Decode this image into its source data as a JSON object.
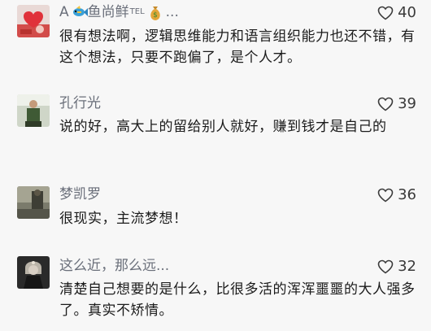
{
  "comments": [
    {
      "username_prefix": "A",
      "username_main": "鱼尚鲜",
      "username_sup": "TEL",
      "username_suffix": "...",
      "likes": "40",
      "text": "很有想法啊，逻辑思维能力和语言组织能力也还不错，有这个想法，只要不跑偏了，是个人才。"
    },
    {
      "username": "孔行光",
      "likes": "39",
      "text": "说的好，高大上的留给别人就好，赚到钱才是自己的"
    },
    {
      "username": "梦凯罗",
      "likes": "36",
      "text": "很现实，主流梦想！"
    },
    {
      "username": "这么近，那么远...",
      "likes": "32",
      "text": "清楚自己想要的是什么，比很多活的浑浑噩噩的大人强多了。真实不矫情。"
    }
  ],
  "colors": {
    "background": "#f7f7f7",
    "username": "#6a6f7a",
    "text": "#1b1b1b"
  },
  "icons": [
    "heart-outline-icon",
    "fish-emoji-icon",
    "money-bag-emoji-icon"
  ]
}
